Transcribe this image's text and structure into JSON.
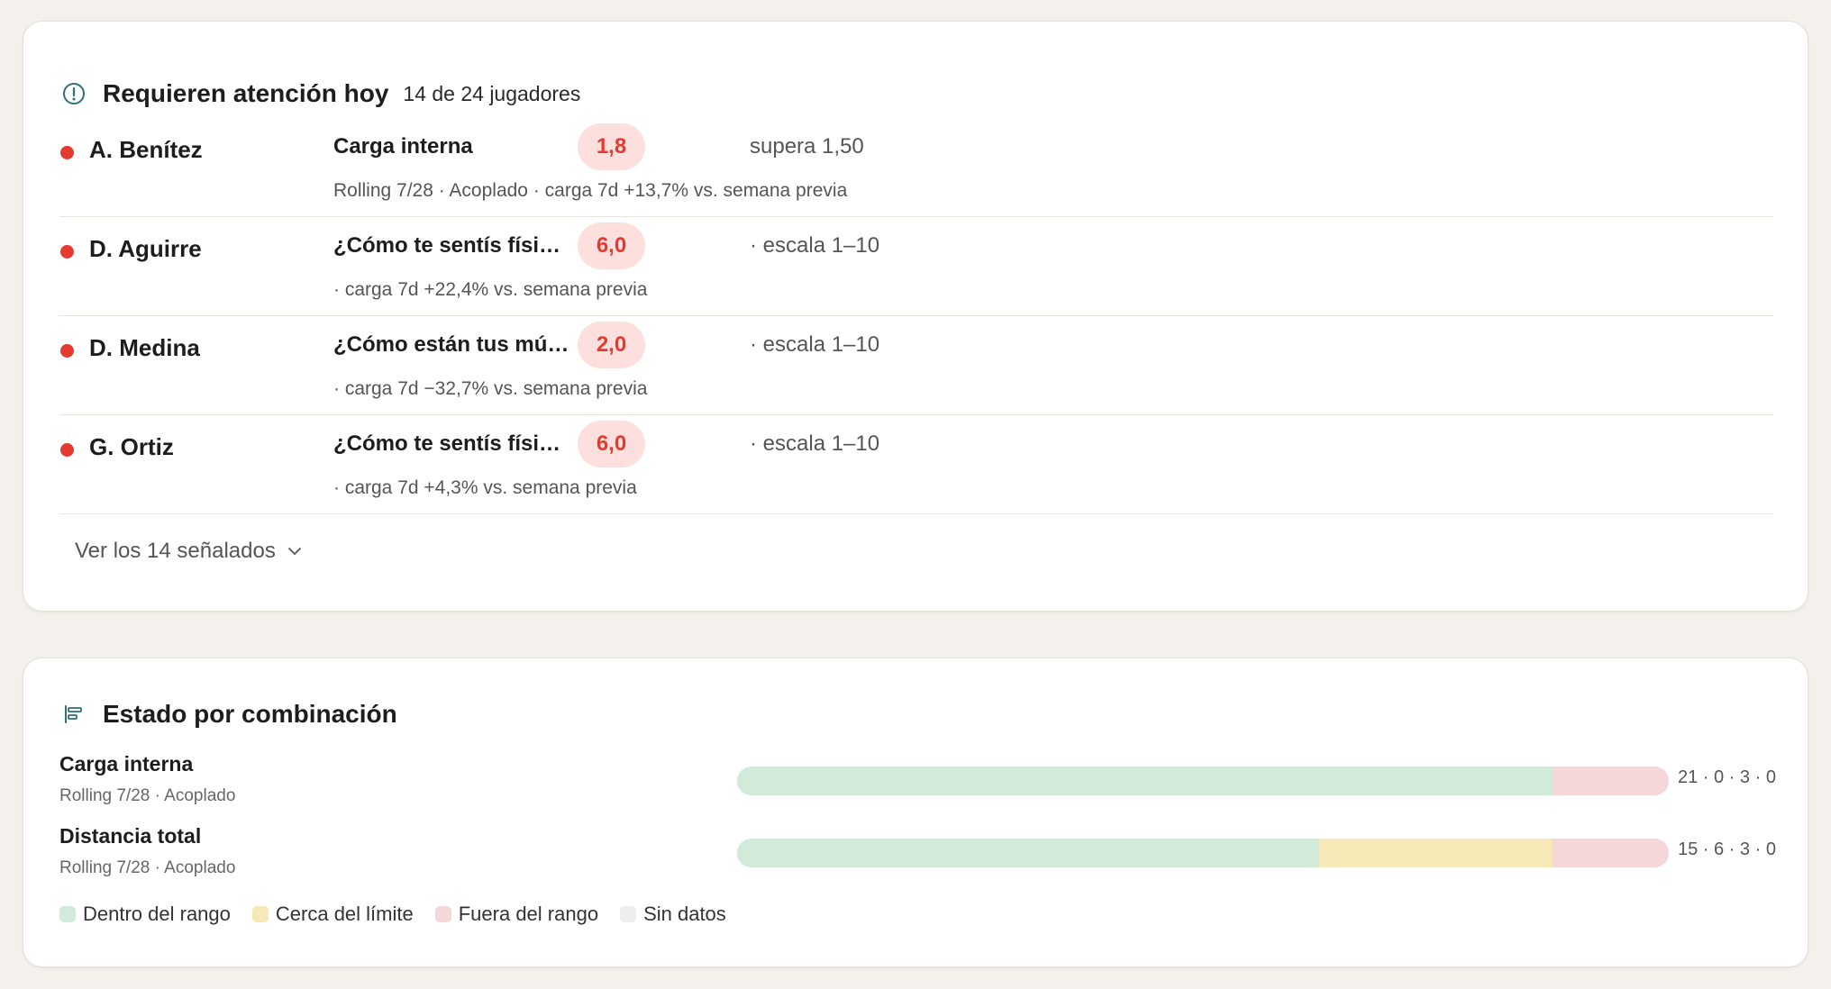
{
  "alerts": {
    "title": "Requieren atención hoy",
    "subtitle": "14 de 24 jugadores",
    "rows": [
      {
        "player": "A. Benítez",
        "metric": "Carga interna",
        "value": "1,8",
        "threshold": "supera 1,50",
        "detail": "Rolling 7/28 · Acoplado · carga 7d +13,7% vs. semana previa"
      },
      {
        "player": "D. Aguirre",
        "metric": "¿Cómo te sentís físicamente?",
        "value": "6,0",
        "threshold": "· escala 1–10",
        "detail": "· carga 7d +22,4% vs. semana previa"
      },
      {
        "player": "D. Medina",
        "metric": "¿Cómo están tus músculos?",
        "value": "2,0",
        "threshold": "· escala 1–10",
        "detail": "· carga 7d −32,7% vs. semana previa"
      },
      {
        "player": "G. Ortiz",
        "metric": "¿Cómo te sentís físicamente?",
        "value": "6,0",
        "threshold": "· escala 1–10",
        "detail": "· carga 7d +4,3% vs. semana previa"
      }
    ],
    "see_all_label": "Ver los 14 señalados"
  },
  "combos": {
    "title": "Estado por combinación",
    "rows": [
      {
        "name": "Carga interna",
        "sub": "Rolling 7/28 · Acoplado",
        "counts": [
          21,
          0,
          3,
          0
        ],
        "counts_label": "21 · 0 · 3 · 0"
      },
      {
        "name": "Distancia total",
        "sub": "Rolling 7/28 · Acoplado",
        "counts": [
          15,
          6,
          3,
          0
        ],
        "counts_label": "15 · 6 · 3 · 0"
      }
    ],
    "legend": [
      {
        "label": "Dentro del rango",
        "color": "#d2eada"
      },
      {
        "label": "Cerca del límite",
        "color": "#f7e8b8"
      },
      {
        "label": "Fuera del rango",
        "color": "#f5d7d9"
      },
      {
        "label": "Sin datos",
        "color": "#eeeeee"
      }
    ]
  },
  "colors": {
    "alert_red": "#e53a30",
    "pill_bg": "#fde0de",
    "accent_teal": "#2f6f78"
  },
  "icons": {
    "alerts_header": "alert-circle-icon",
    "combos_header": "bar-list-icon",
    "see_all": "chevron-down-icon"
  }
}
